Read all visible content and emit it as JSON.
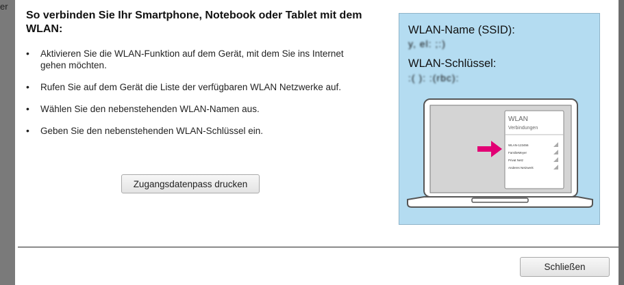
{
  "backdrop": {
    "fragment": "er"
  },
  "dialog": {
    "title": "So verbinden Sie Ihr Smartphone, Notebook oder Tablet mit dem WLAN:",
    "steps": [
      "Aktivieren Sie die WLAN-Funktion auf dem Gerät, mit dem Sie ins Internet gehen möchten.",
      "Rufen Sie auf dem Gerät die Liste der verfügbaren WLAN Netzwerke auf.",
      "Wählen Sie den nebenstehenden WLAN-Namen aus.",
      "Geben Sie den nebenstehenden WLAN-Schlüssel ein."
    ],
    "print_button": "Zugangsdatenpass drucken",
    "close_button": "Schließen"
  },
  "info_card": {
    "ssid_label": "WLAN-Name (SSID):",
    "ssid_value": "y, el: ;:)",
    "key_label": "WLAN-Schlüssel:",
    "key_value": ":( ): :(rbc):",
    "illustration": {
      "panel_title": "WLAN",
      "panel_subtitle": "Verbindungen",
      "networks": [
        "WLAN-123456",
        "FamilieMeyer",
        "Privat Netz",
        "Anderes Netzwerk"
      ]
    }
  },
  "colors": {
    "card_background": "#b4dcf1",
    "arrow": "#e20074"
  }
}
